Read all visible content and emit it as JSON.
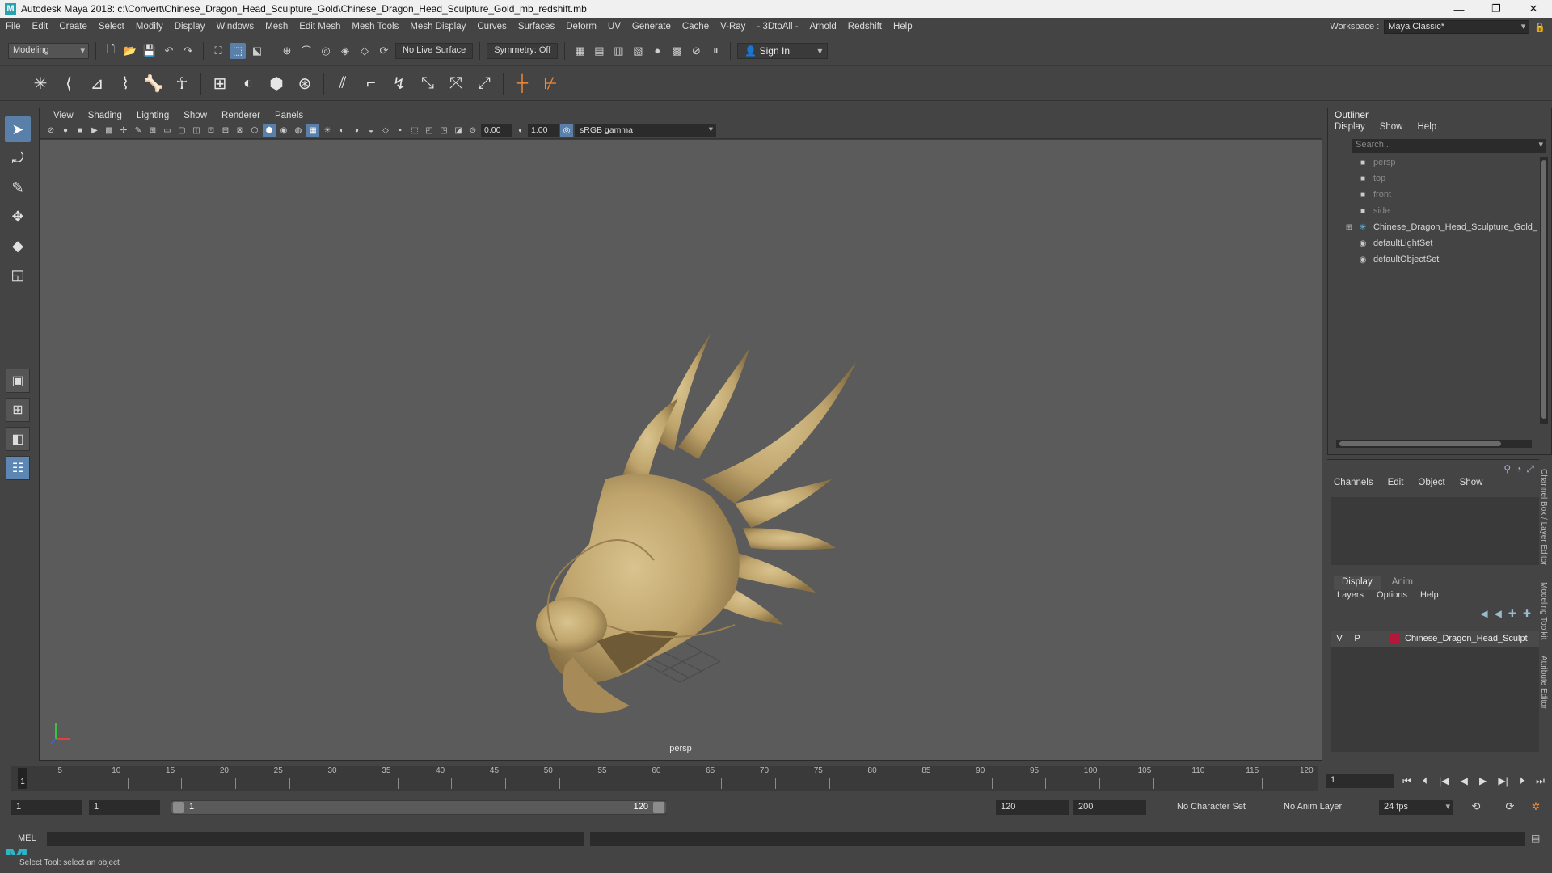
{
  "window": {
    "title": "Autodesk Maya 2018: c:\\Convert\\Chinese_Dragon_Head_Sculpture_Gold\\Chinese_Dragon_Head_Sculpture_Gold_mb_redshift.mb",
    "app_icon": "M"
  },
  "menubar": {
    "items": [
      "File",
      "Edit",
      "Create",
      "Select",
      "Modify",
      "Display",
      "Windows",
      "Mesh",
      "Edit Mesh",
      "Mesh Tools",
      "Mesh Display",
      "Curves",
      "Surfaces",
      "Deform",
      "UV",
      "Generate",
      "Cache",
      "V-Ray",
      "- 3DtoAll -",
      "Arnold",
      "Redshift",
      "Help"
    ],
    "workspace_label": "Workspace :",
    "workspace_value": "Maya Classic*"
  },
  "statusline": {
    "mode": "Modeling",
    "live_surface": "No Live Surface",
    "symmetry": "Symmetry: Off",
    "sign_in": "Sign In"
  },
  "panel": {
    "menus": [
      "View",
      "Shading",
      "Lighting",
      "Show",
      "Renderer",
      "Panels"
    ],
    "exposure": "0.00",
    "gamma": "1.00",
    "color_space": "sRGB gamma",
    "camera": "persp"
  },
  "outliner": {
    "title": "Outliner",
    "menus": [
      "Display",
      "Show",
      "Help"
    ],
    "search_placeholder": "Search...",
    "items": [
      {
        "label": "persp",
        "kind": "camera"
      },
      {
        "label": "top",
        "kind": "camera"
      },
      {
        "label": "front",
        "kind": "camera"
      },
      {
        "label": "side",
        "kind": "camera"
      },
      {
        "label": "Chinese_Dragon_Head_Sculpture_Gold_",
        "kind": "group"
      },
      {
        "label": "defaultLightSet",
        "kind": "set"
      },
      {
        "label": "defaultObjectSet",
        "kind": "set"
      }
    ]
  },
  "channelbox": {
    "menus": [
      "Channels",
      "Edit",
      "Object",
      "Show"
    ]
  },
  "layer_editor": {
    "tabs": [
      "Display",
      "Anim"
    ],
    "menus": [
      "Layers",
      "Options",
      "Help"
    ],
    "layer": {
      "v": "V",
      "p": "P",
      "name": "Chinese_Dragon_Head_Sculpt",
      "color": "#b5163a"
    }
  },
  "side_tabs": [
    "Channel Box / Layer Editor",
    "Modeling Toolkit",
    "Attribute Editor"
  ],
  "timeline": {
    "ticks": [
      "5",
      "10",
      "15",
      "20",
      "25",
      "30",
      "35",
      "40",
      "45",
      "50",
      "55",
      "60",
      "65",
      "70",
      "75",
      "80",
      "85",
      "90",
      "95",
      "100",
      "105",
      "110",
      "115",
      "120"
    ],
    "current_frame": "1",
    "frame_field": "1"
  },
  "range": {
    "start": "1",
    "playback_start": "1",
    "slider_start": "1",
    "slider_end": "120",
    "playback_end": "120",
    "end": "200",
    "character_set": "No Character Set",
    "anim_layer": "No Anim Layer",
    "fps": "24 fps"
  },
  "cmdline": {
    "mel": "MEL"
  },
  "helpline": {
    "text": "Select Tool: select an object"
  }
}
